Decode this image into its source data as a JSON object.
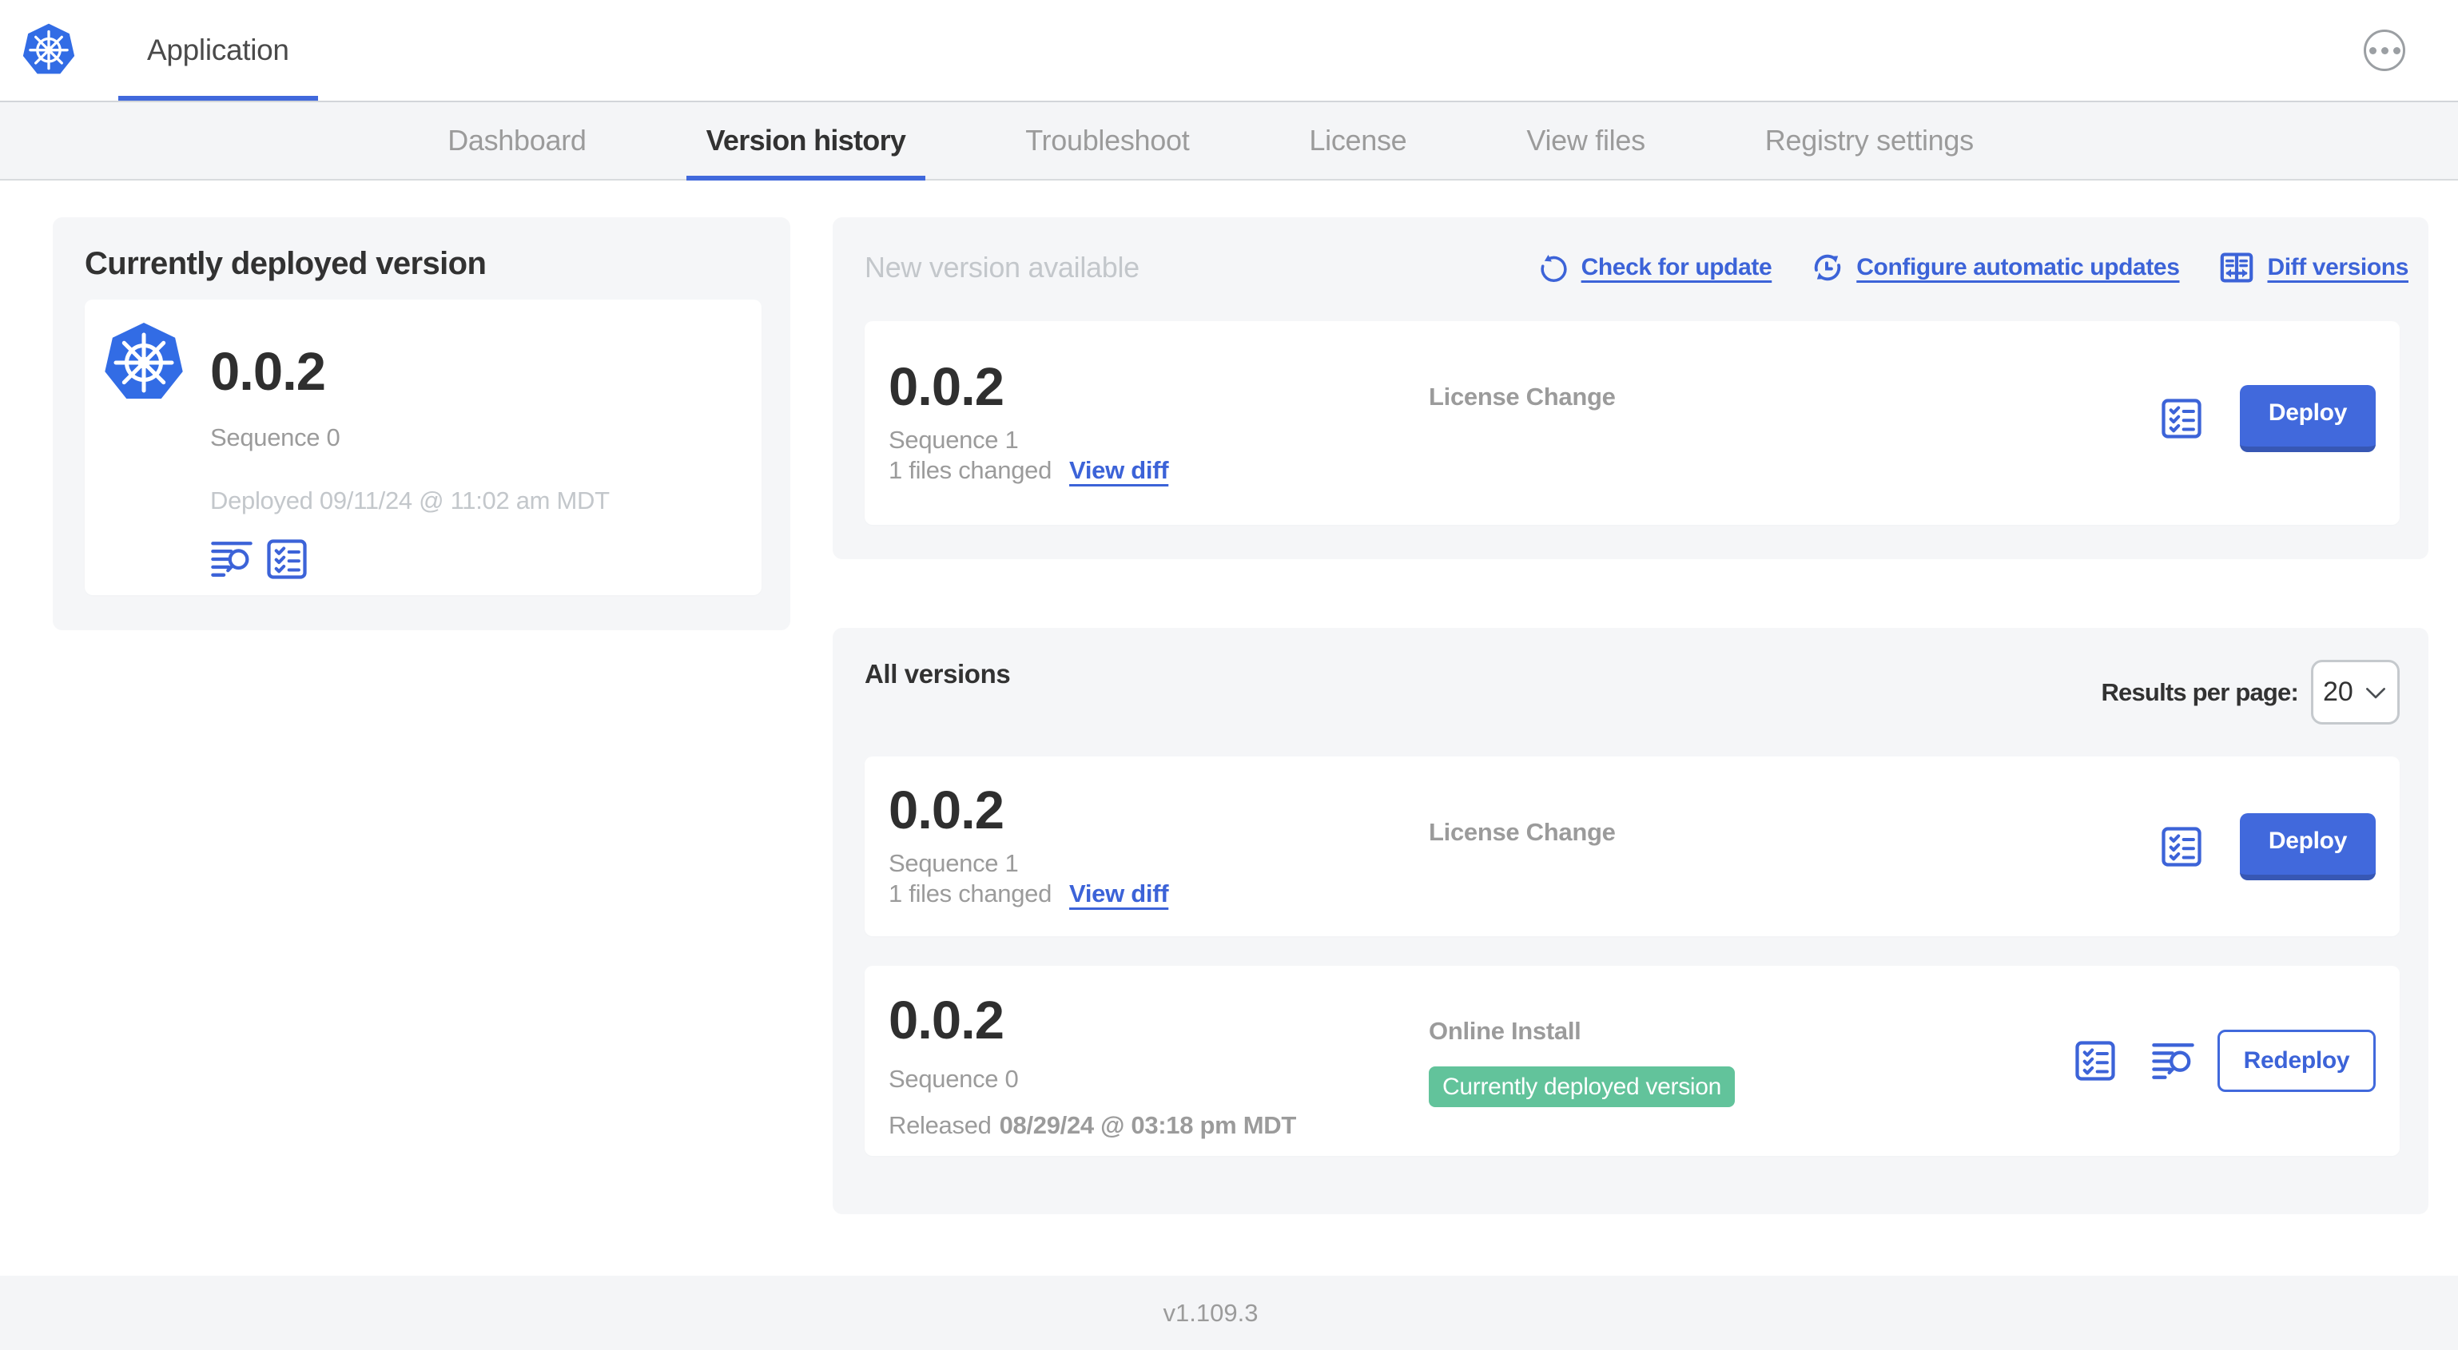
{
  "colors": {
    "accent_blue": "#4169dc",
    "link_blue": "#3c63d8",
    "k8s_blue": "#326ce5",
    "badge_green": "#62c39b",
    "panel_grey": "#f5f6f8",
    "muted_text": "#9b9b9b",
    "light_text": "#c3c7cb",
    "dark_text": "#323232"
  },
  "header": {
    "app_name": "Application"
  },
  "nav": {
    "tabs": [
      {
        "label": "Dashboard",
        "active": false
      },
      {
        "label": "Version history",
        "active": true
      },
      {
        "label": "Troubleshoot",
        "active": false
      },
      {
        "label": "License",
        "active": false
      },
      {
        "label": "View files",
        "active": false
      },
      {
        "label": "Registry settings",
        "active": false
      }
    ]
  },
  "deployed_panel": {
    "title": "Currently deployed version",
    "version": "0.0.2",
    "sequence": "Sequence 0",
    "deployed_at": "Deployed 09/11/24 @ 11:02 am MDT"
  },
  "new_version_panel": {
    "title": "New version available",
    "actions": {
      "check_for_update": "Check for update",
      "configure_automatic_updates": "Configure automatic updates",
      "diff_versions": "Diff versions"
    },
    "card": {
      "version": "0.0.2",
      "sequence": "Sequence 1",
      "files_changed": "1 files changed",
      "view_diff": "View diff",
      "type": "License Change",
      "action": "Deploy"
    }
  },
  "all_versions_panel": {
    "title": "All versions",
    "results_per_page_label": "Results per page:",
    "results_per_page_value": "20",
    "cards": [
      {
        "version": "0.0.2",
        "sequence": "Sequence 1",
        "files_changed": "1 files changed",
        "view_diff": "View diff",
        "type": "License Change",
        "action": "Deploy"
      },
      {
        "version": "0.0.2",
        "sequence": "Sequence 0",
        "released_label": "Released",
        "released_date": "08/29/24 @ 03:18 pm MDT",
        "type": "Online Install",
        "badge": "Currently deployed version",
        "action": "Redeploy"
      }
    ]
  },
  "footer": {
    "version": "v1.109.3"
  }
}
